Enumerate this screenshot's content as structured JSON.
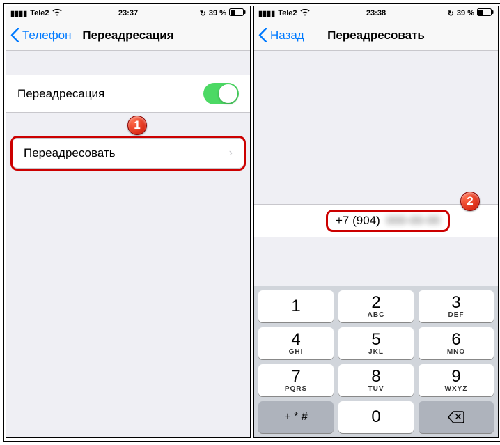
{
  "status": {
    "carrier": "Tele2",
    "time": "23:37",
    "battery": "39 %",
    "time2": "23:38"
  },
  "left": {
    "back": "Телефон",
    "title": "Переадресация",
    "row_toggle": "Переадресация",
    "row_forward": "Переадресовать",
    "badge": "1"
  },
  "right": {
    "back": "Назад",
    "title": "Переадресовать",
    "phone_prefix": "+7 (904)",
    "phone_rest": "000-00-00",
    "badge": "2"
  },
  "keypad": {
    "k1": {
      "n": "1",
      "l": ""
    },
    "k2": {
      "n": "2",
      "l": "ABC"
    },
    "k3": {
      "n": "3",
      "l": "DEF"
    },
    "k4": {
      "n": "4",
      "l": "GHI"
    },
    "k5": {
      "n": "5",
      "l": "JKL"
    },
    "k6": {
      "n": "6",
      "l": "MNO"
    },
    "k7": {
      "n": "7",
      "l": "PQRS"
    },
    "k8": {
      "n": "8",
      "l": "TUV"
    },
    "k9": {
      "n": "9",
      "l": "WXYZ"
    },
    "kstar": "+ * #",
    "k0": "0"
  }
}
